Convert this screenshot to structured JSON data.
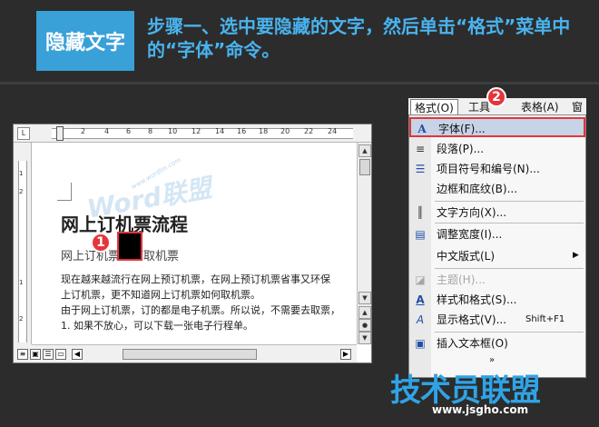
{
  "header": {
    "title": "隐藏文字",
    "instruction": "步骤一、选中要隐藏的文字，然后单击“格式”菜单中的“字体”命令。"
  },
  "word": {
    "ruler_labels": [
      "2",
      "4",
      "6",
      "8",
      "10",
      "12",
      "14",
      "16",
      "18",
      "20",
      "22",
      "24"
    ],
    "vruler_labels": [
      "1",
      "2",
      "1",
      "2"
    ],
    "watermark": "Word联盟",
    "watermark_url": "www.wordlm.com",
    "heading": "网上订机票流程",
    "subheading": "网上订机票如何取机票",
    "paragraphs": [
      "现在越来越流行在网上预订机票，在网上预订机票省事又环保",
      "上订机票，更不知道网上订机票如何取机票。",
      "由于网上订机票，订的都是电子机票。所以说，不需要去取票，",
      "1. 如果不放心，可以下载一张电子行程单。"
    ]
  },
  "badges": {
    "one": "1",
    "two": "2"
  },
  "menubar": {
    "items": [
      "格式(O)",
      "工具",
      "表格(A)",
      "窗"
    ]
  },
  "menu": {
    "items": [
      {
        "icon": "A",
        "label": "字体(F)...",
        "shortcut": "",
        "arrow": ""
      },
      {
        "icon": "≡",
        "label": "段落(P)...",
        "shortcut": "",
        "arrow": ""
      },
      {
        "icon": "☰",
        "label": "项目符号和编号(N)...",
        "shortcut": "",
        "arrow": ""
      },
      {
        "icon": "",
        "label": "边框和底纹(B)...",
        "shortcut": "",
        "arrow": ""
      },
      {
        "icon": "║",
        "label": "文字方向(X)...",
        "shortcut": "",
        "arrow": ""
      },
      {
        "icon": "▤",
        "label": "调整宽度(I)...",
        "shortcut": "",
        "arrow": ""
      },
      {
        "icon": "",
        "label": "中文版式(L)",
        "shortcut": "",
        "arrow": "▶"
      },
      {
        "icon": "◪",
        "label": "主题(H)...",
        "shortcut": "",
        "arrow": ""
      },
      {
        "icon": "A",
        "label": "样式和格式(S)...",
        "shortcut": "",
        "arrow": ""
      },
      {
        "icon": "A",
        "label": "显示格式(V)...",
        "shortcut": "Shift+F1",
        "arrow": ""
      },
      {
        "icon": "▣",
        "label": "插入文本框(O)",
        "shortcut": "",
        "arrow": ""
      }
    ],
    "more": "»"
  },
  "logo": {
    "text": "技术员联盟",
    "url": "www.jsgho.com"
  }
}
